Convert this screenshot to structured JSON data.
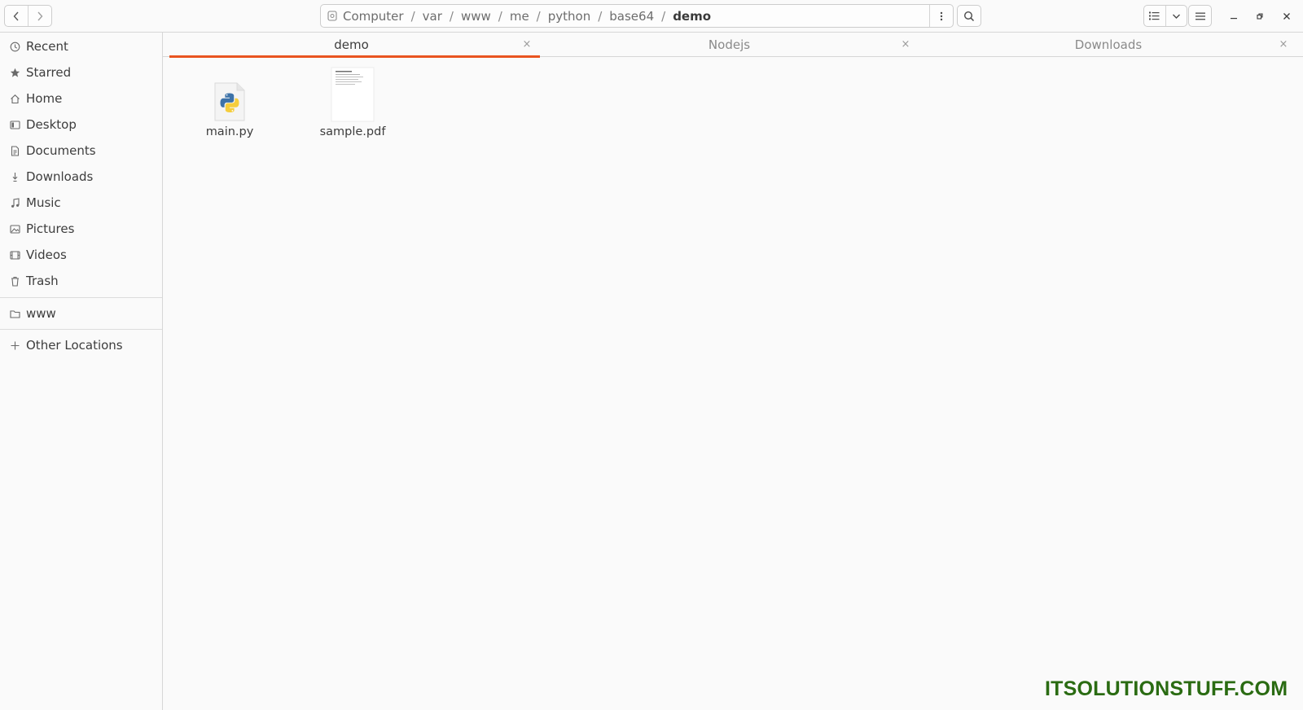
{
  "header": {
    "path": [
      "Computer",
      "var",
      "www",
      "me",
      "python",
      "base64"
    ],
    "current": "demo",
    "separator": "/"
  },
  "sidebar": {
    "items": [
      {
        "label": "Recent",
        "icon": "clock-icon"
      },
      {
        "label": "Starred",
        "icon": "star-icon"
      },
      {
        "label": "Home",
        "icon": "home-icon"
      },
      {
        "label": "Desktop",
        "icon": "desktop-icon"
      },
      {
        "label": "Documents",
        "icon": "document-icon"
      },
      {
        "label": "Downloads",
        "icon": "download-icon"
      },
      {
        "label": "Music",
        "icon": "music-icon"
      },
      {
        "label": "Pictures",
        "icon": "picture-icon"
      },
      {
        "label": "Videos",
        "icon": "video-icon"
      },
      {
        "label": "Trash",
        "icon": "trash-icon"
      }
    ],
    "bookmarks": [
      {
        "label": "www",
        "icon": "folder-icon"
      }
    ],
    "other": {
      "label": "Other Locations",
      "icon": "plus-icon"
    }
  },
  "tabs": [
    {
      "label": "demo",
      "active": true
    },
    {
      "label": "Nodejs",
      "active": false
    },
    {
      "label": "Downloads",
      "active": false
    }
  ],
  "files": [
    {
      "name": "main.py",
      "icon": "python-file-icon"
    },
    {
      "name": "sample.pdf",
      "icon": "pdf-thumbnail-icon"
    }
  ],
  "watermark": "ITSOLUTIONSTUFF.COM",
  "colors": {
    "accent": "#e95420",
    "watermark": "#2a6b12",
    "background": "#fafafa"
  }
}
